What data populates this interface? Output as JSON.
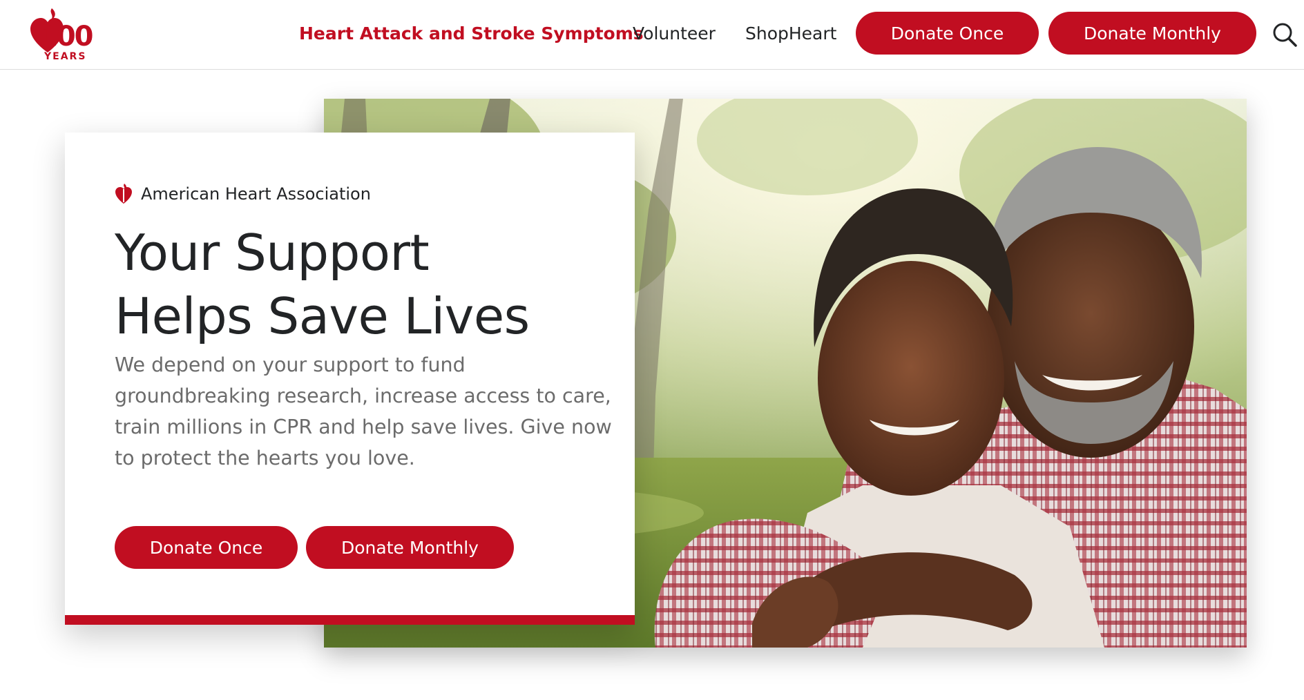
{
  "brand": {
    "logo_number": "100",
    "logo_word": "YEARS",
    "accent_color": "#c10e21"
  },
  "nav": {
    "links": [
      {
        "label": "Heart Attack and Stroke Symptoms"
      },
      {
        "label": "Volunteer"
      },
      {
        "label": "ShopHeart"
      }
    ],
    "donate_once": "Donate Once",
    "donate_monthly": "Donate Monthly",
    "search_icon": "search-icon"
  },
  "hero": {
    "org_name": "American Heart Association",
    "org_icon": "heart-torch-icon",
    "headline_line1": "Your Support",
    "headline_line2": "Helps Save Lives",
    "body": "We depend on your support to fund groundbreaking research, increase access to care, train millions in CPR and help save lives. Give now to protect the hearts you love.",
    "donate_once": "Donate Once",
    "donate_monthly": "Donate Monthly",
    "photo": "smiling-couple-embracing-outdoors"
  }
}
